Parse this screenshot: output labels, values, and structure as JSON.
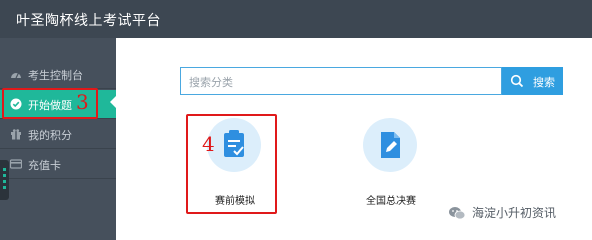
{
  "header": {
    "title": "叶圣陶杯线上考试平台"
  },
  "sidebar": {
    "items": [
      {
        "label": "考生控制台",
        "icon": "dashboard-icon"
      },
      {
        "label": "开始做题",
        "icon": "check-circle-icon",
        "active": true
      },
      {
        "label": "我的积分",
        "icon": "gift-icon"
      },
      {
        "label": "充值卡",
        "icon": "card-icon"
      }
    ]
  },
  "annotations": {
    "sidebar_number": "3",
    "card_number": "4",
    "color": "#e0191a"
  },
  "search": {
    "placeholder": "搜索分类",
    "button_label": "搜索"
  },
  "cards": [
    {
      "label": "赛前模拟",
      "icon": "clipboard-check-icon"
    },
    {
      "label": "全国总决赛",
      "icon": "document-edit-icon"
    }
  ],
  "watermark": {
    "text": "海淀小升初资讯",
    "icon": "wechat-icon"
  },
  "colors": {
    "accent": "#1fb89a",
    "header": "#3d4752",
    "sidebar": "#46505c",
    "primary": "#2f9ee0"
  }
}
